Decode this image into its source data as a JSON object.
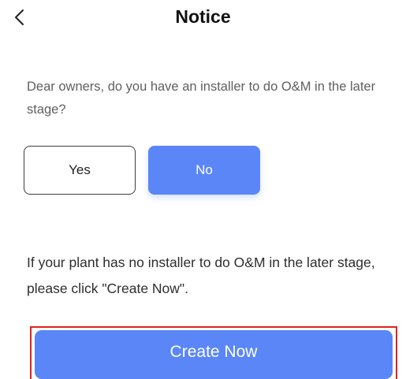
{
  "header": {
    "title": "Notice",
    "back_icon": "chevron-left-icon"
  },
  "question": {
    "text": "Dear owners, do you have an installer to do O&M in the later stage?"
  },
  "choices": {
    "yes_label": "Yes",
    "no_label": "No",
    "selected": "No"
  },
  "info": {
    "text": "If your plant has no installer to do O&M in the later stage, please click \"Create Now\"."
  },
  "actions": {
    "create_label": "Create Now"
  },
  "colors": {
    "accent": "#5a86f7",
    "highlight_border": "#e0201f",
    "question_text": "#5f5f5f",
    "body_text": "#2e2e2e"
  }
}
